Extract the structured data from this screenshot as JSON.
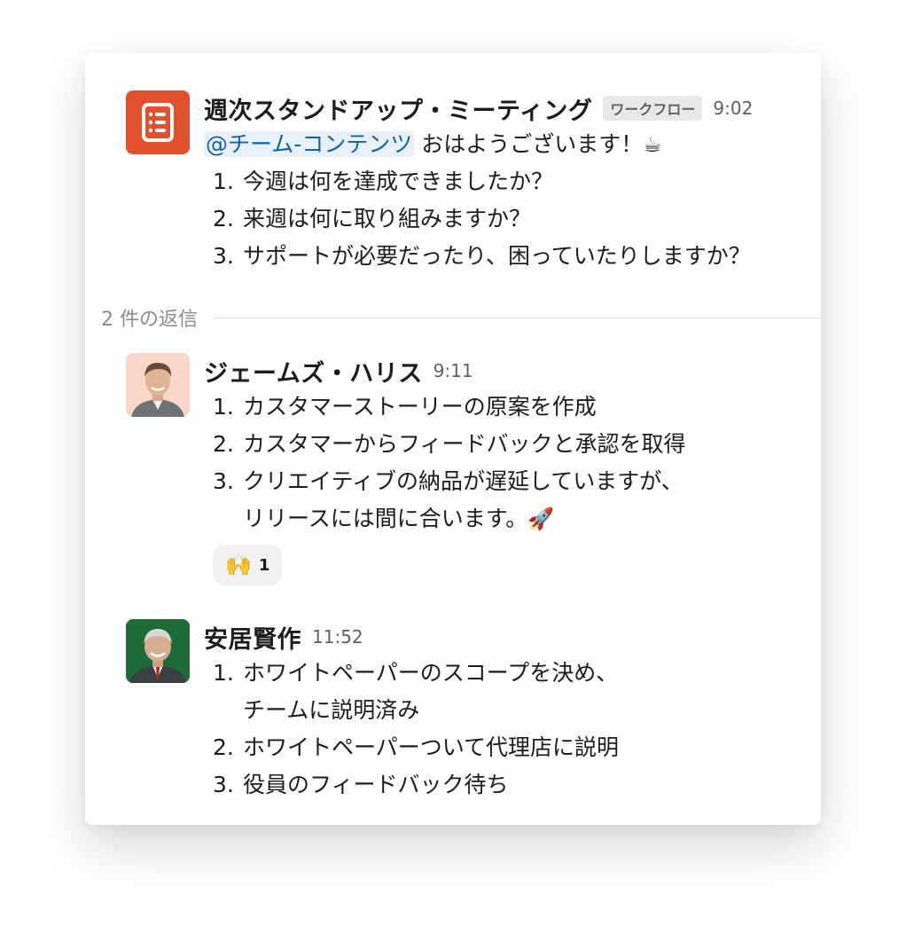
{
  "thread": {
    "parent": {
      "author": "週次スタンドアップ・ミーティング",
      "badge": "ワークフロー",
      "time": "9:02",
      "mention": "@チーム-コンテンツ",
      "greeting": "おはようございます！",
      "greeting_emoji": "☕",
      "items": [
        "今週は何を達成できましたか？",
        "来週は何に取り組みますか？",
        "サポートが必要だったり、困っていたりしますか？"
      ]
    },
    "replies_label": "2 件の返信",
    "replies": [
      {
        "author": "ジェームズ・ハリス",
        "time": "9:11",
        "items": [
          "カスタマーストーリーの原案を作成",
          "カスタマーからフィードバックと承認を取得",
          "クリエイティブの納品が遅延していますが、",
          "リリースには間に合います。"
        ],
        "item3_emoji": "🚀",
        "reaction": {
          "emoji": "🙌",
          "count": "1"
        }
      },
      {
        "author": "安居賢作",
        "time": "11:52",
        "items": [
          "ホワイトペーパーのスコープを決め、",
          "チームに説明済み",
          "ホワイトペーパーついて代理店に説明",
          "役員のフィードバック待ち"
        ]
      }
    ],
    "numbers": [
      "1.",
      "2.",
      "3."
    ]
  },
  "colors": {
    "workflow_icon_bg": "#e0522d",
    "mention_text": "#1264a3",
    "mention_bg": "#e8f1fb"
  },
  "icons": {
    "workflow": "document-list-icon"
  }
}
